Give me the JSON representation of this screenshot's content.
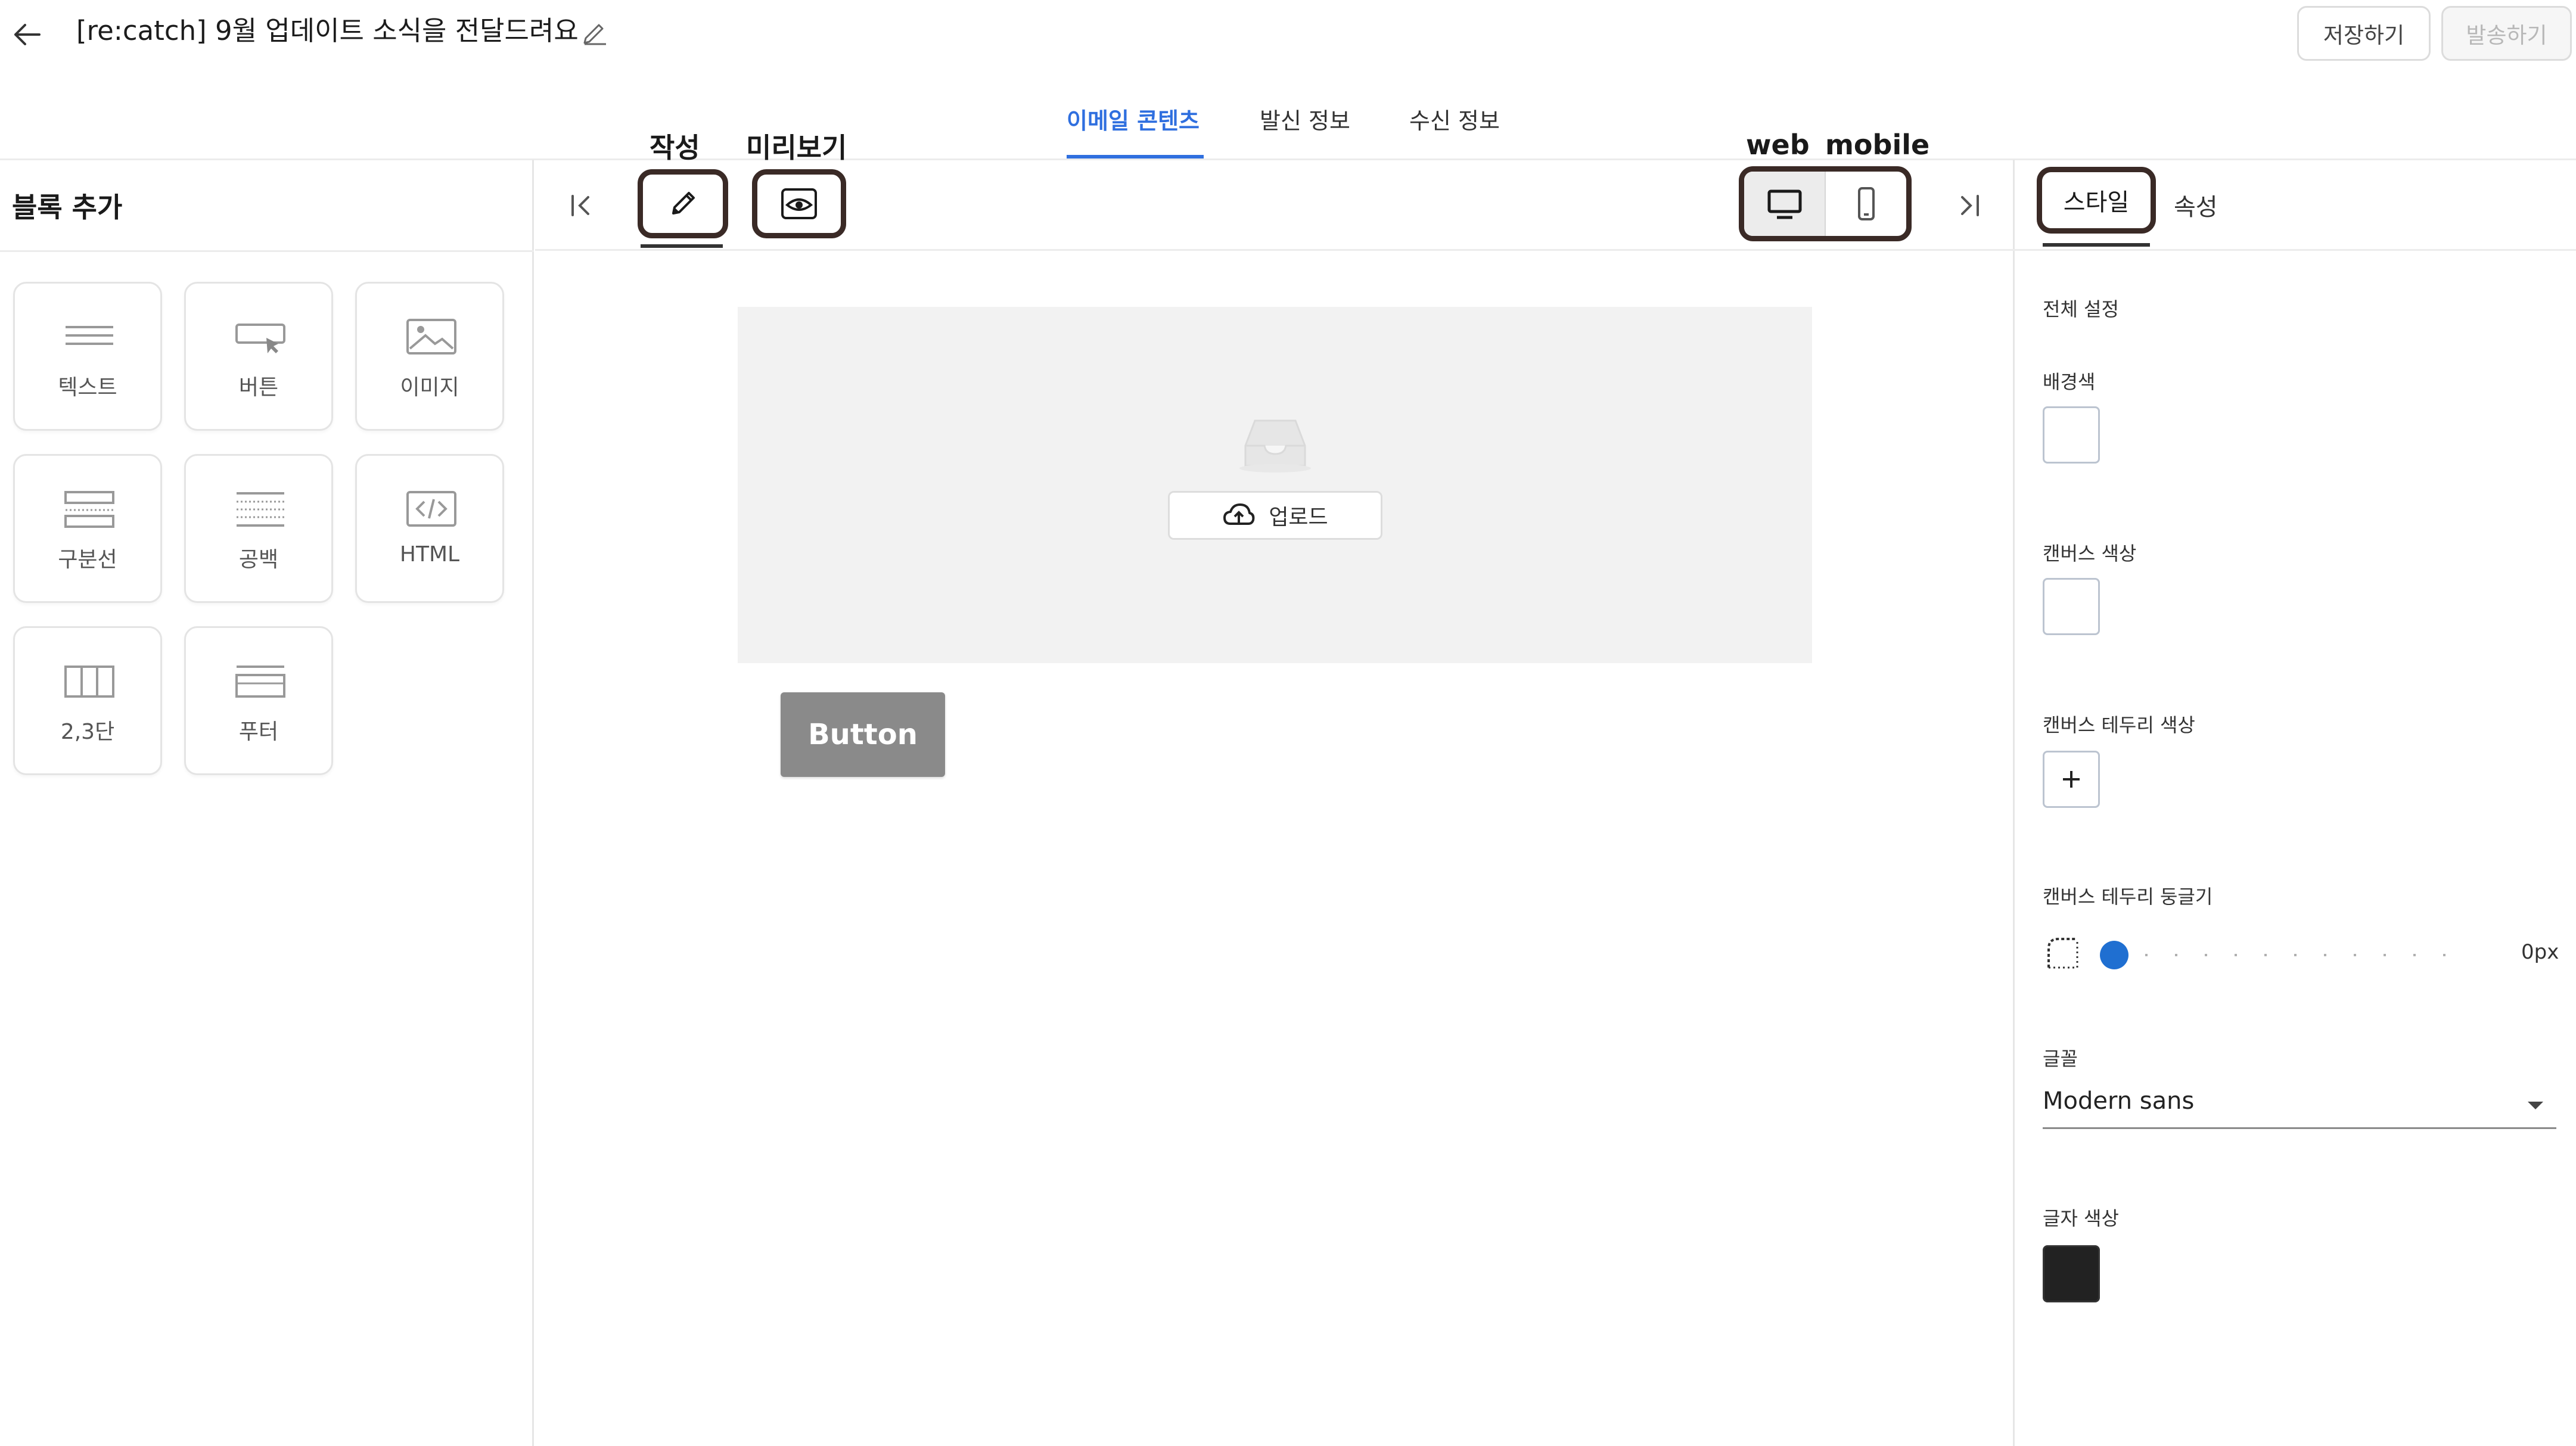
{
  "header": {
    "title": "[re:catch] 9월 업데이트 소식을 전달드려요",
    "save_label": "저장하기",
    "send_label": "발송하기"
  },
  "tabs": [
    {
      "label": "이메일 콘텐츠",
      "active": true
    },
    {
      "label": "발신 정보",
      "active": false
    },
    {
      "label": "수신 정보",
      "active": false
    }
  ],
  "annotations": {
    "edit": "작성",
    "preview": "미리보기",
    "web": "web",
    "mobile": "mobile"
  },
  "left_panel": {
    "title": "블록 추가",
    "blocks": [
      {
        "label": "텍스트",
        "icon": "text-lines-icon"
      },
      {
        "label": "버튼",
        "icon": "button-cursor-icon"
      },
      {
        "label": "이미지",
        "icon": "image-icon"
      },
      {
        "label": "구분선",
        "icon": "divider-icon"
      },
      {
        "label": "공백",
        "icon": "spacer-icon"
      },
      {
        "label": "HTML",
        "icon": "code-icon"
      },
      {
        "label": "2,3단",
        "icon": "columns-icon"
      },
      {
        "label": "푸터",
        "icon": "footer-icon"
      }
    ]
  },
  "canvas": {
    "upload_label": "업로드",
    "button_label": "Button"
  },
  "right_panel": {
    "tabs": [
      {
        "label": "스타일",
        "active": true
      },
      {
        "label": "속성",
        "active": false
      }
    ],
    "section_title": "전체 설정",
    "background_label": "배경색",
    "canvas_color_label": "캔버스 색상",
    "canvas_border_color_label": "캔버스 테두리 색상",
    "canvas_border_radius_label": "캔버스 테두리 둥글기",
    "canvas_border_radius_value": "0px",
    "font_label": "글꼴",
    "font_value": "Modern sans",
    "text_color_label": "글자 색상",
    "text_color": "#222222"
  },
  "colors": {
    "accent": "#2f6fdf",
    "slider": "#1f6fd1",
    "annotation_border": "#3a2a26"
  }
}
